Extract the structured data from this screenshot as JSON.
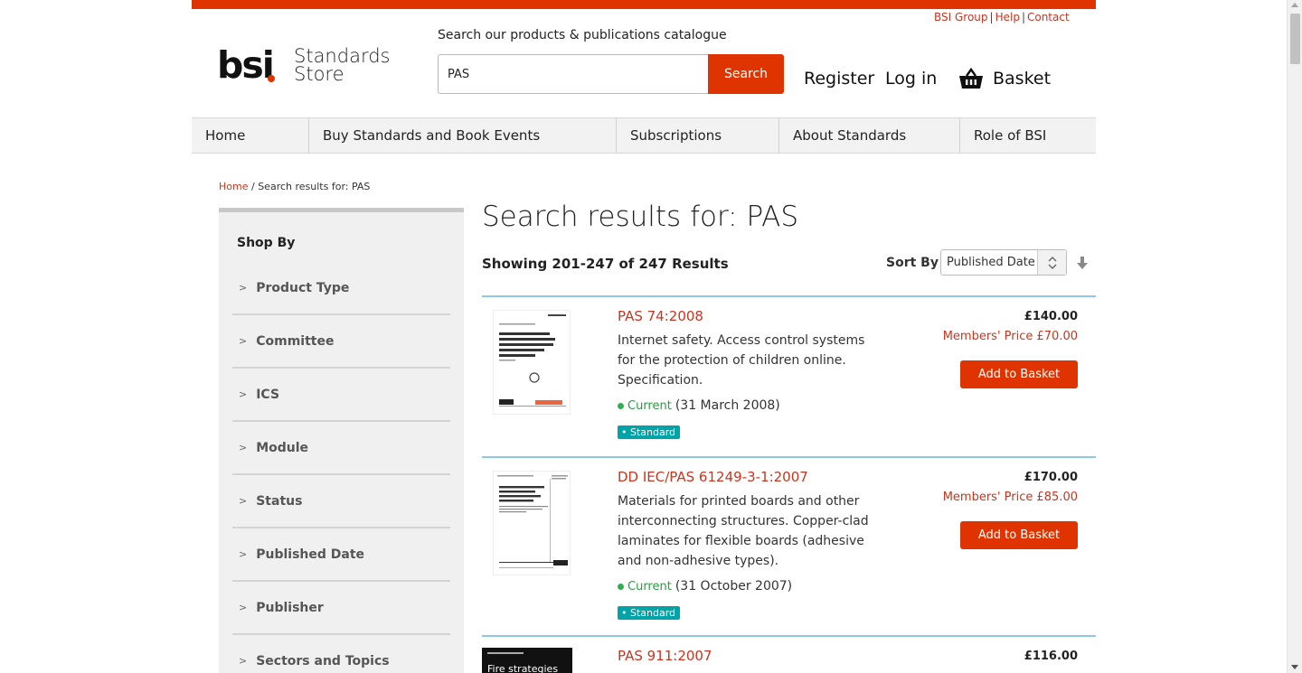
{
  "header": {
    "top_links": [
      "BSI Group",
      "Help",
      "Contact"
    ],
    "logo_text": "bsi",
    "store_line1": "Standards",
    "store_line2": "Store",
    "search_label": "Search our products & publications catalogue",
    "search_value": "PAS",
    "search_button": "Search",
    "register": "Register",
    "login": "Log in",
    "basket": "Basket"
  },
  "nav": [
    "Home",
    "Buy Standards and Book Events",
    "Subscriptions",
    "About Standards",
    "Role of BSI"
  ],
  "breadcrumb": {
    "home": "Home",
    "current": "Search results for: PAS"
  },
  "sidebar": {
    "heading": "Shop By",
    "facets": [
      "Product Type",
      "Committee",
      "ICS",
      "Module",
      "Status",
      "Published Date",
      "Publisher",
      "Sectors and Topics"
    ]
  },
  "results": {
    "title": "Search results for: PAS",
    "showing": "Showing 201-247 of 247 Results",
    "sort_label": "Sort By",
    "sort_value": "Published Date",
    "items": [
      {
        "title": "PAS 74:2008",
        "description": "Internet safety. Access control systems for the protection of children online. Specification.",
        "status": "Current",
        "date": "(31 March 2008)",
        "badge": "Standard",
        "price": "£140.00",
        "members_price": "Members' Price £70.00",
        "button": "Add to Basket"
      },
      {
        "title": "DD IEC/PAS 61249-3-1:2007",
        "description": "Materials for printed boards and other interconnecting structures. Copper-clad laminates for flexible boards (adhesive and non-adhesive types).",
        "status": "Current",
        "date": "(31 October 2007)",
        "badge": "Standard",
        "price": "£170.00",
        "members_price": "Members' Price £85.00",
        "button": "Add to Basket"
      },
      {
        "title": "PAS 911:2007",
        "thumb_text": "Fire strategies",
        "price": "£116.00"
      }
    ]
  },
  "colors": {
    "brand": "#e03400",
    "link": "#c8351e",
    "badge": "#00a3a7",
    "status": "#2fb14e",
    "divider": "#8ec8e8"
  }
}
